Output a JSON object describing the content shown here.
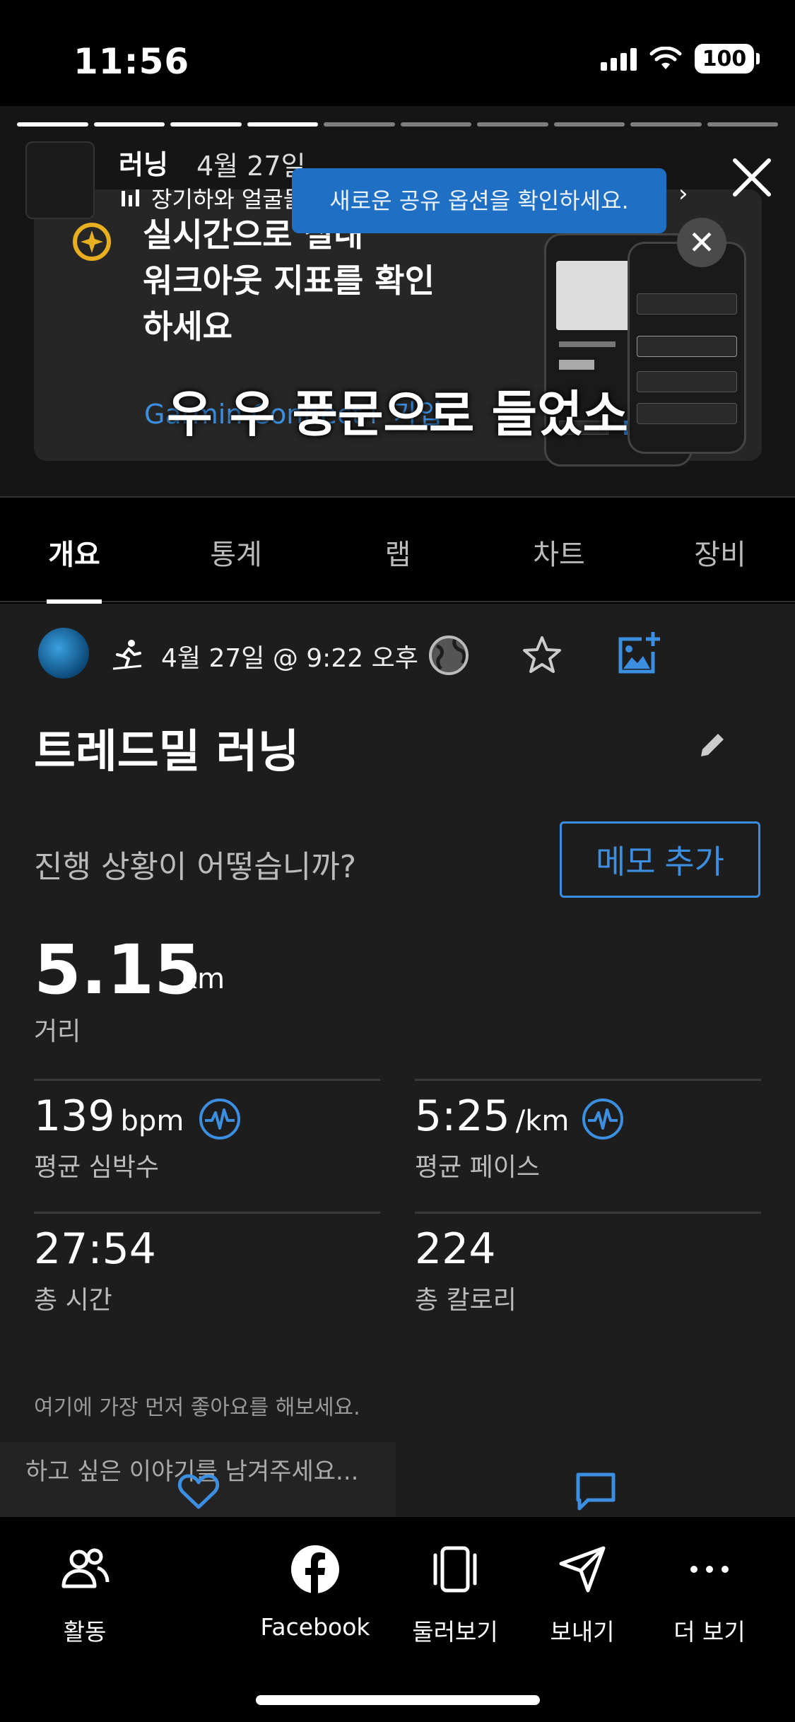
{
  "status": {
    "time": "11:56",
    "battery": "100"
  },
  "story": {
    "name": "러닝",
    "date": "4월 27일",
    "music": "장기하와 얼굴들 · 별일없이 산다",
    "tooltip": "새로운 공유 옵션을 확인하세요.",
    "caption": "우 우 풍문으로 들었소",
    "progress_total": 10,
    "progress_done": 4
  },
  "promo": {
    "text_line1": "실시간으로 실내",
    "text_line2": "워크아웃 지표를 확인",
    "text_line3": "하세요",
    "link": "Garmin Connect+ 가입"
  },
  "tabs": [
    {
      "label": "개요"
    },
    {
      "label": "통계"
    },
    {
      "label": "랩"
    },
    {
      "label": "차트"
    },
    {
      "label": "장비"
    }
  ],
  "activity": {
    "datetime": "4월 27일 @ 9:22 오후",
    "title": "트레드밀 러닝",
    "feel_question": "진행 상황이 어떻습니까?",
    "memo_button": "메모 추가"
  },
  "stats": {
    "distance": {
      "value": "5.15",
      "unit": "km",
      "label": "거리"
    },
    "avg_hr": {
      "value": "139",
      "unit": "bpm",
      "label": "평균 심박수"
    },
    "avg_pace": {
      "value": "5:25",
      "unit": "/km",
      "label": "평균 페이스"
    },
    "total_time": {
      "value": "27:54",
      "label": "총 시간"
    },
    "total_calories": {
      "value": "224",
      "label": "총 칼로리"
    }
  },
  "social": {
    "like_prompt": "여기에 가장 먼저 좋아요를 해보세요.",
    "comment_placeholder": "하고 싶은 이야기를 남겨주세요..."
  },
  "bottom_bar": [
    {
      "label": "활동",
      "icon": "people-icon"
    },
    {
      "label": "Facebook",
      "icon": "facebook-icon"
    },
    {
      "label": "둘러보기",
      "icon": "browse-icon"
    },
    {
      "label": "보내기",
      "icon": "send-icon"
    },
    {
      "label": "더 보기",
      "icon": "more-icon"
    }
  ],
  "colors": {
    "accent": "#3c8fe0",
    "tooltip": "#1f6fc4",
    "background": "#1d1d1d"
  }
}
